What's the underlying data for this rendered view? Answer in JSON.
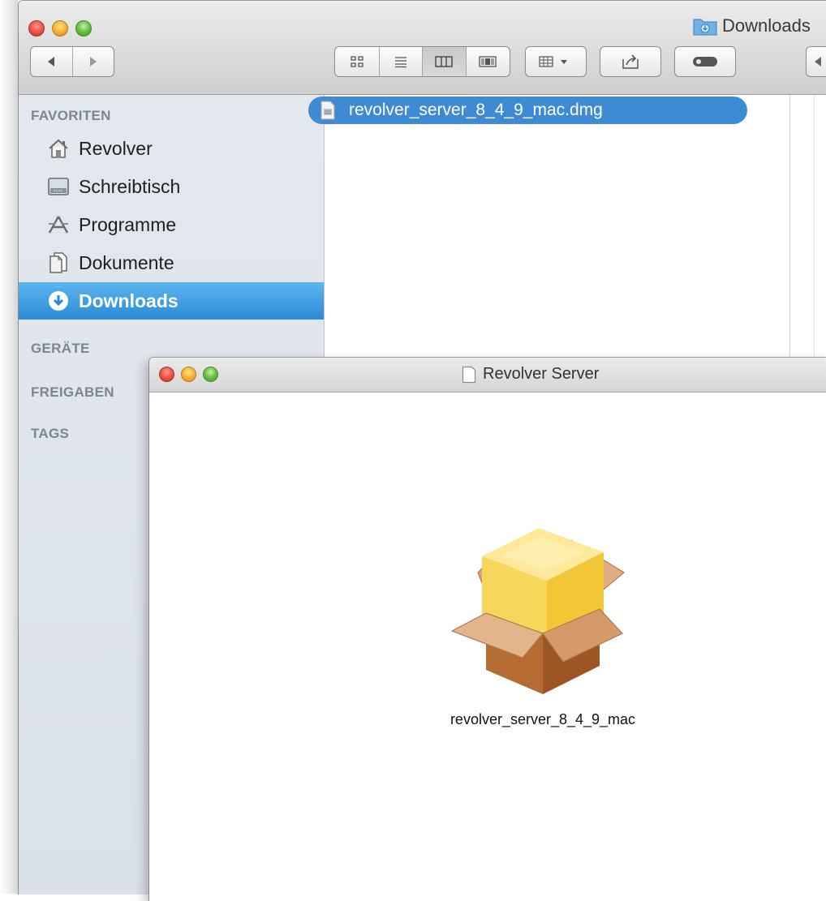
{
  "finder_window": {
    "title": "Downloads",
    "toolbar": {
      "back_icon": "back-arrow-icon",
      "forward_icon": "forward-arrow-icon",
      "view_icons": [
        "icon-view-icon",
        "list-view-icon",
        "column-view-icon",
        "coverflow-view-icon"
      ],
      "arrange_icon": "arrange-icon",
      "share_icon": "share-icon",
      "tags_icon": "tag-toggle-icon"
    },
    "sidebar": {
      "favorites_header": "FAVORITEN",
      "items": [
        {
          "label": "Revolver",
          "icon": "home-icon"
        },
        {
          "label": "Schreibtisch",
          "icon": "desktop-icon"
        },
        {
          "label": "Programme",
          "icon": "applications-icon"
        },
        {
          "label": "Dokumente",
          "icon": "documents-icon"
        },
        {
          "label": "Downloads",
          "icon": "downloads-icon",
          "selected": true
        }
      ],
      "devices_header": "GERÄTE",
      "shared_header": "FREIGABEN",
      "tags_header": "TAGS"
    },
    "file": "revolver_server_8_4_9_mac.dmg"
  },
  "package_window": {
    "title": "Revolver Server",
    "item_label": "revolver_server_8_4_9_mac"
  },
  "colors": {
    "selection_blue": "#3e8bd3",
    "sidebar_bg": "#e0e6ed",
    "sidebar_header": "#7b8593"
  }
}
